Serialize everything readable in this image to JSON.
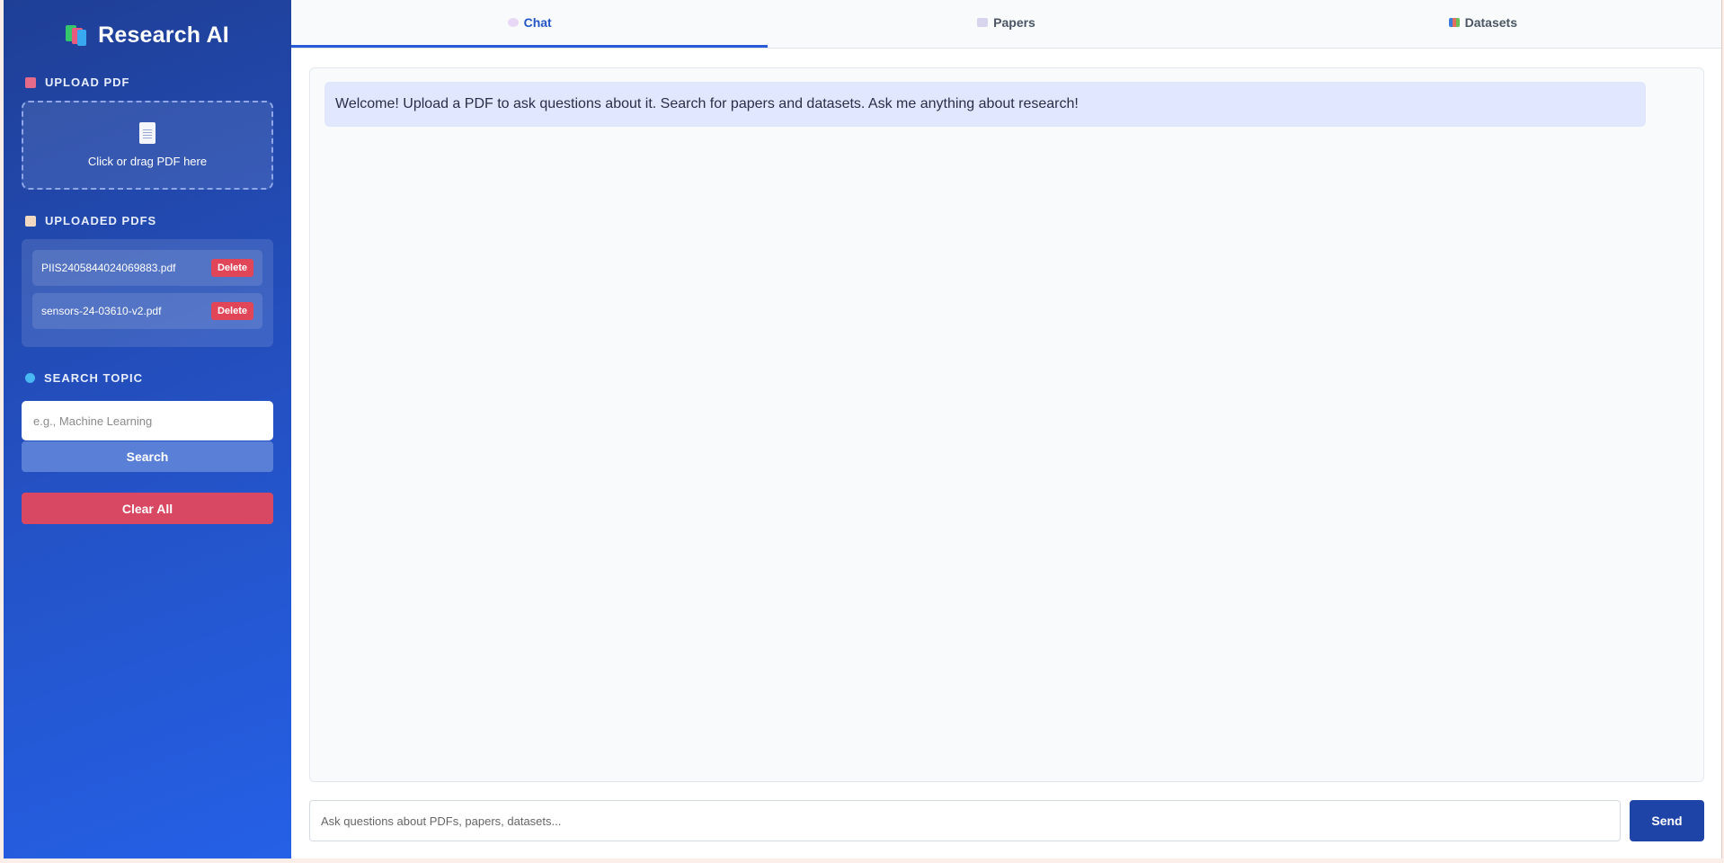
{
  "sidebar": {
    "brand": "Research AI",
    "upload": {
      "title": "Upload PDF",
      "dropzone_text": "Click or drag PDF here"
    },
    "uploaded": {
      "title": "Uploaded PDFs",
      "items": [
        {
          "name": "PIIS2405844024069883.pdf",
          "delete_label": "Delete"
        },
        {
          "name": "sensors-24-03610-v2.pdf",
          "delete_label": "Delete"
        }
      ]
    },
    "search": {
      "title": "Search Topic",
      "placeholder": "e.g., Machine Learning",
      "button_label": "Search"
    },
    "clear_label": "Clear All"
  },
  "tabs": [
    {
      "label": "Chat",
      "icon": "speech-bubble-icon",
      "active": true
    },
    {
      "label": "Papers",
      "icon": "document-icon",
      "active": false
    },
    {
      "label": "Datasets",
      "icon": "bar-chart-icon",
      "active": false
    }
  ],
  "chat": {
    "welcome": "Welcome! Upload a PDF to ask questions about it. Search for papers and datasets. Ask me anything about research!",
    "input_placeholder": "Ask questions about PDFs, papers, datasets...",
    "send_label": "Send"
  },
  "colors": {
    "sidebar_gradient_start": "#1f3f96",
    "sidebar_gradient_end": "#2560e6",
    "accent": "#2a5bd7",
    "danger": "#d84862",
    "message_bg": "#e0e7ff"
  }
}
